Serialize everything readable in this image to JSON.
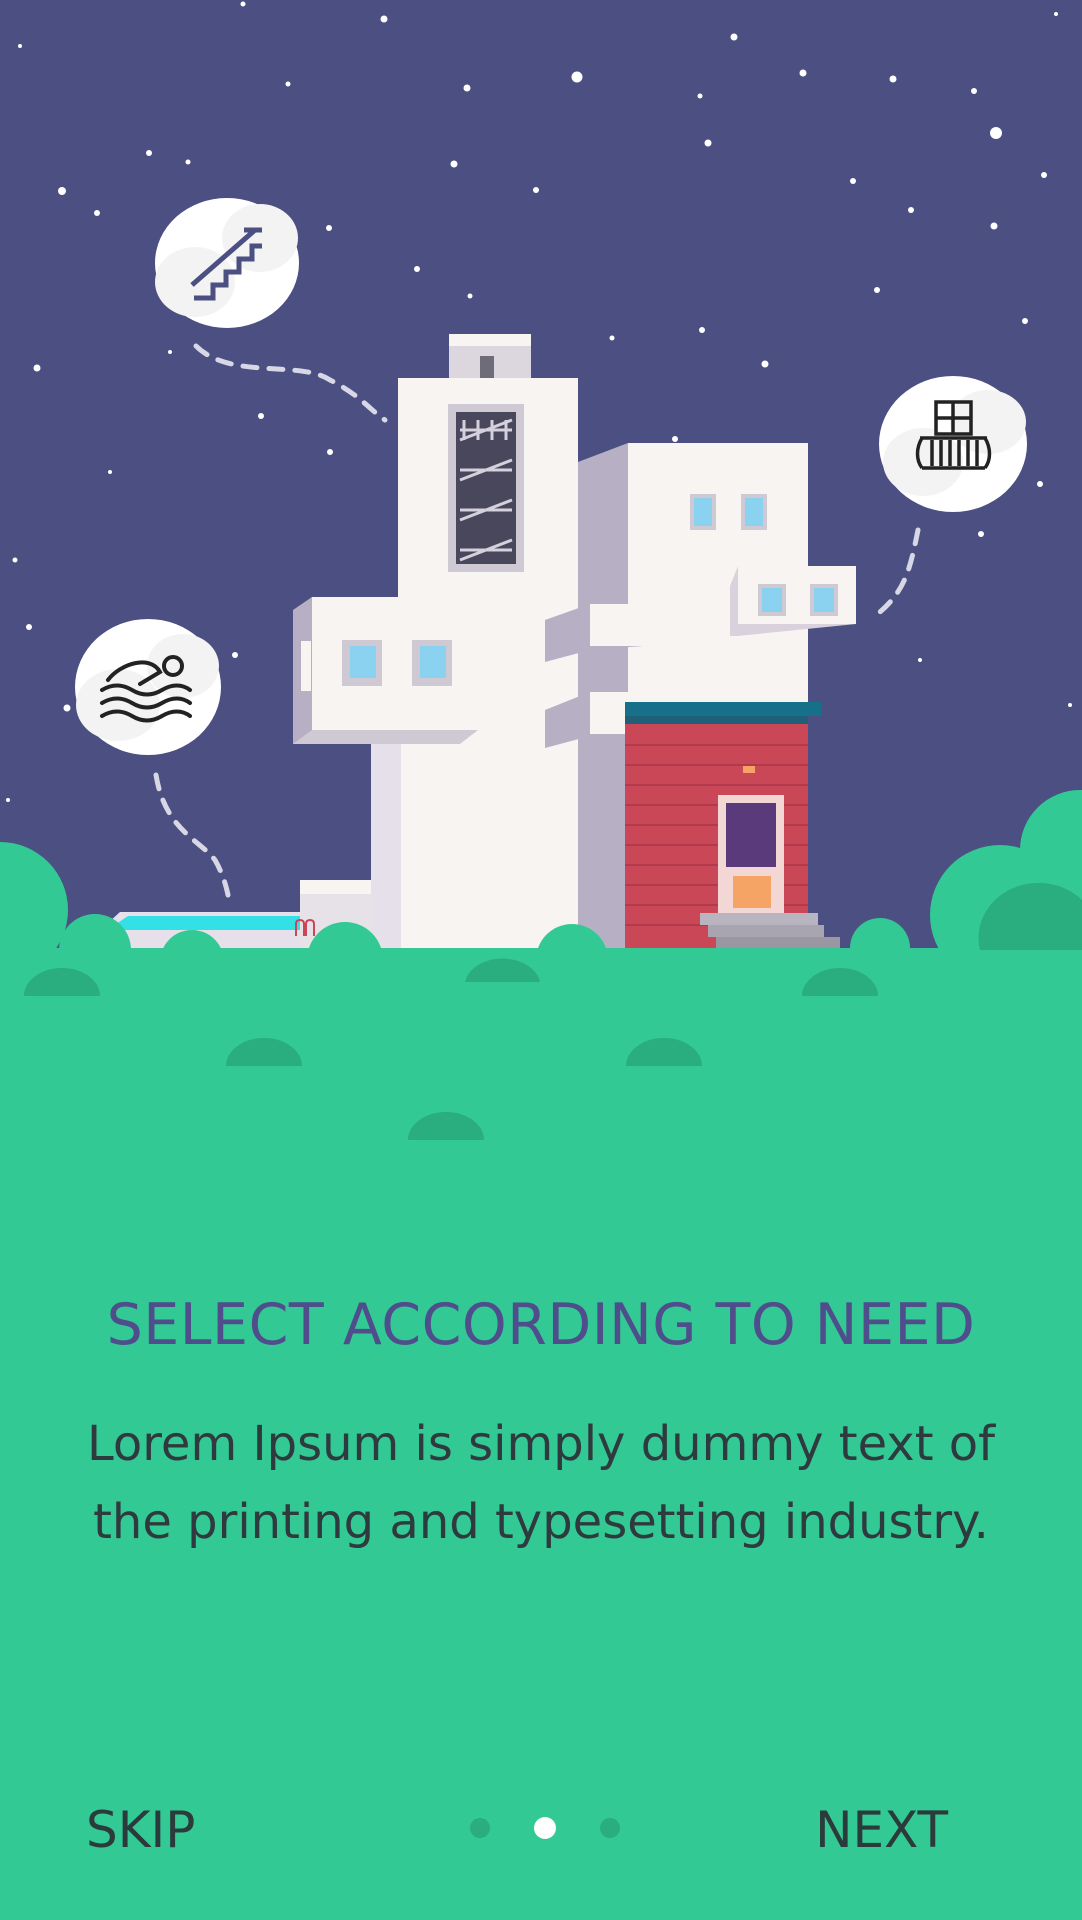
{
  "colors": {
    "sky": "#4b4f82",
    "ground": "#33c995",
    "ground_dark": "#2aad7f",
    "title": "#4f4d8b",
    "body_text": "#2f3a3e",
    "building": "#f7f4f2",
    "brick": "#c94757",
    "pool": "#33e0e6"
  },
  "illustration": {
    "icons": [
      "stairs-icon",
      "swimming-icon",
      "balcony-icon"
    ]
  },
  "onboarding": {
    "title": "SELECT ACCORDING TO NEED",
    "description": "Lorem Ipsum is simply dummy text of the printing and typesetting industry."
  },
  "footer": {
    "skip_label": "SKIP",
    "next_label": "NEXT",
    "page_count": 3,
    "active_page": 2
  }
}
